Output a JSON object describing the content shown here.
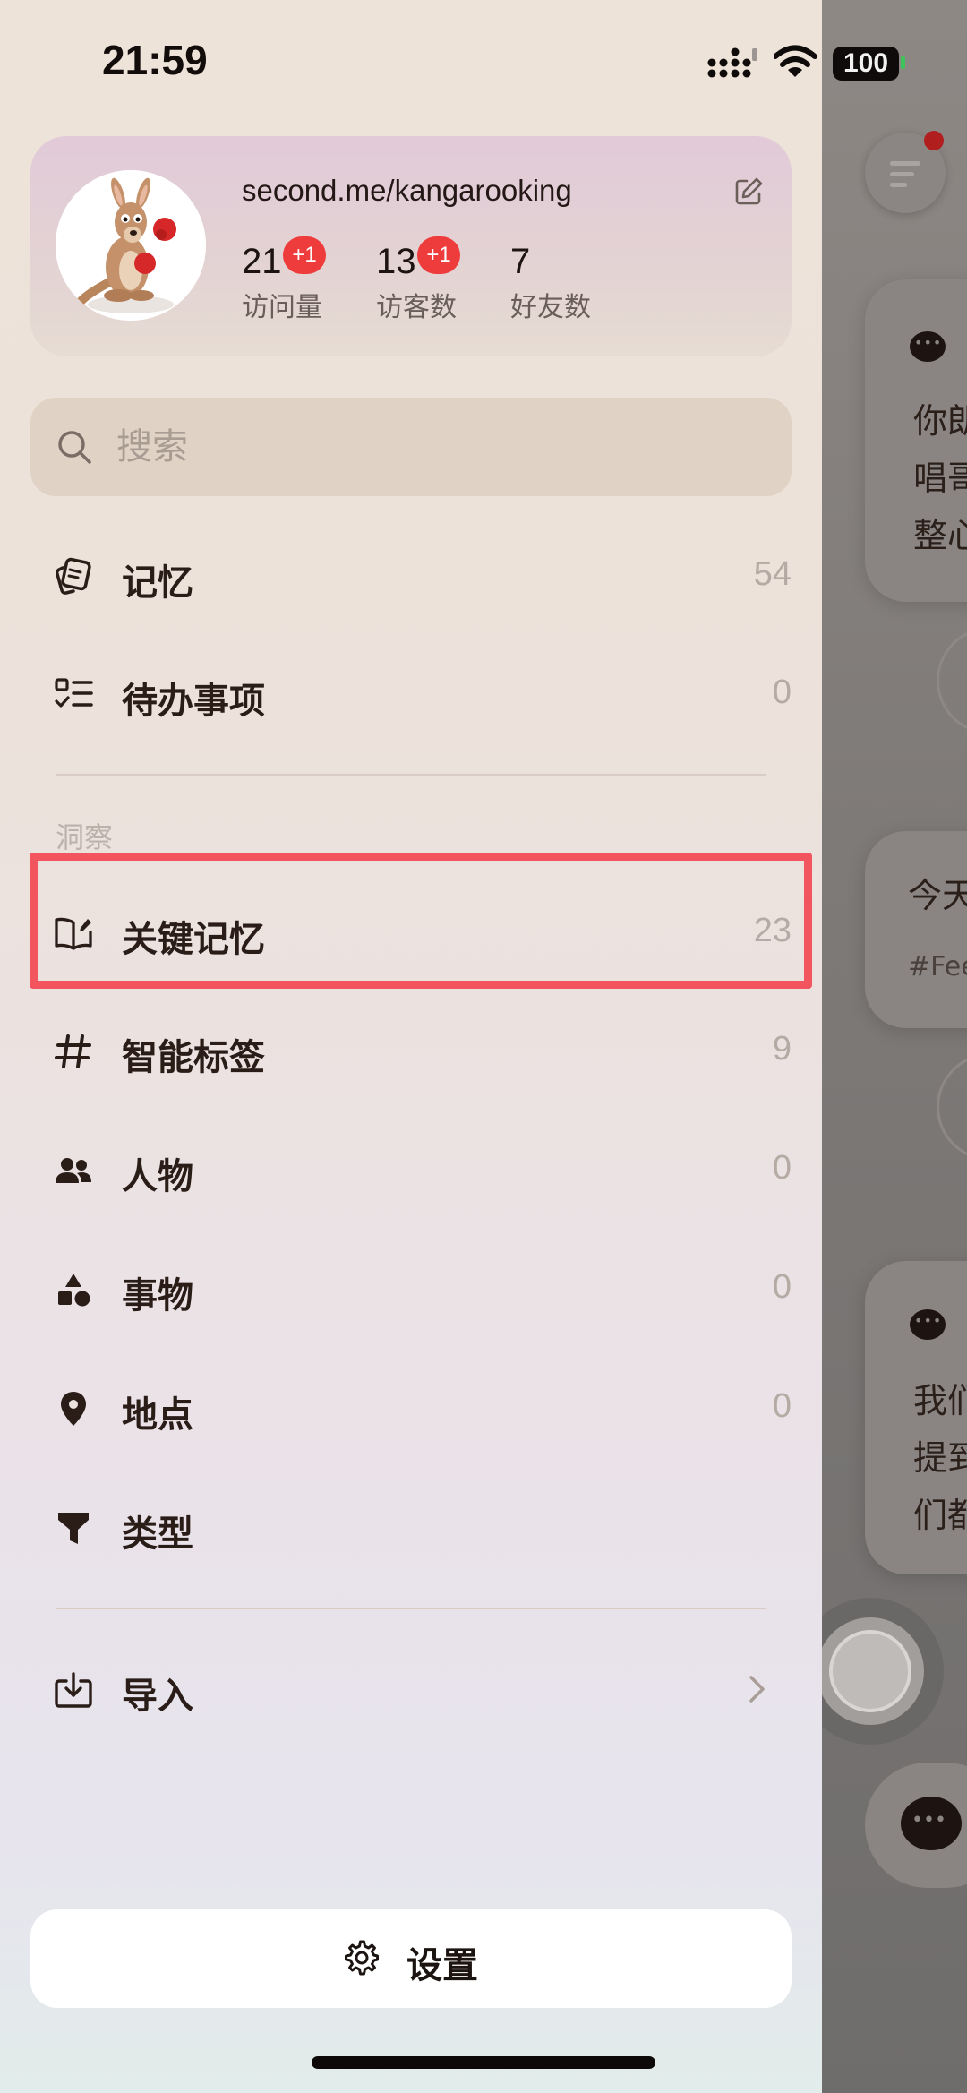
{
  "status_bar": {
    "time": "21:59",
    "battery": "100"
  },
  "profile": {
    "url": "second.me/kangarooking",
    "stats": [
      {
        "value": "21",
        "badge": "+1",
        "label": "访问量"
      },
      {
        "value": "13",
        "badge": "+1",
        "label": "访客数"
      },
      {
        "value": "7",
        "label": "好友数"
      }
    ]
  },
  "search": {
    "placeholder": "搜索"
  },
  "menu": [
    {
      "label": "记忆",
      "count": "54",
      "icon": "memory-cards-icon"
    },
    {
      "label": "待办事项",
      "count": "0",
      "icon": "todo-list-icon"
    }
  ],
  "insights": {
    "title": "洞察",
    "items": [
      {
        "label": "关键记忆",
        "count": "23",
        "icon": "book-edit-icon"
      },
      {
        "label": "智能标签",
        "count": "9",
        "icon": "hashtag-icon"
      },
      {
        "label": "人物",
        "count": "0",
        "icon": "people-icon"
      },
      {
        "label": "事物",
        "count": "0",
        "icon": "shapes-icon"
      },
      {
        "label": "地点",
        "count": "0",
        "icon": "location-pin-icon"
      },
      {
        "label": "类型",
        "count": "",
        "icon": "filter-icon"
      }
    ]
  },
  "import": {
    "label": "导入",
    "icon": "import-icon"
  },
  "settings": {
    "label": "设置"
  },
  "background": {
    "cards": [
      {
        "lines": [
          "你朗",
          "唱哥",
          "整心"
        ]
      },
      {
        "lines": [
          "今天"
        ],
        "tag": "#Fee"
      },
      {
        "lines": [
          "我们",
          "提到",
          "们都"
        ]
      }
    ]
  },
  "colors": {
    "highlight": "#f2555d",
    "badge": "#ee3b3b",
    "accent_dot": "#b01e1e"
  }
}
